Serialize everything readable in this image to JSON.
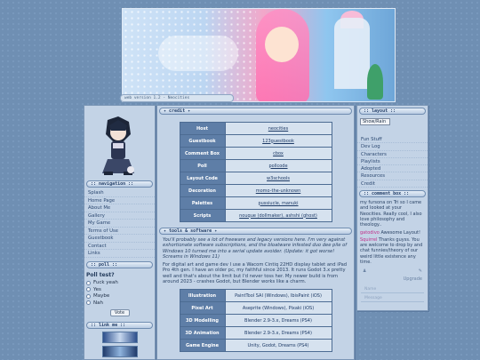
{
  "version_bar": "web version 1.2 - Neocities",
  "nav": {
    "title": ":: navigation ::",
    "items": [
      "Splash",
      "Home Page",
      "About Me",
      "Gallery",
      "My Game",
      "Terms of Use",
      "Guestbook",
      "Contact",
      "Links"
    ]
  },
  "poll": {
    "title": ":: poll ::",
    "question": "Poll test?",
    "options": [
      "Fuck yeah",
      "Yes",
      "Maybe",
      "Nah"
    ],
    "vote": "Vote"
  },
  "link_me": {
    "title": ":: link me ::"
  },
  "credit": {
    "title": "✦ credit ✦",
    "rows": [
      {
        "k": "Host",
        "v": "neocities"
      },
      {
        "k": "Guestbook",
        "v": "123guestbook"
      },
      {
        "k": "Comment Box",
        "v": "cbox"
      },
      {
        "k": "Poll",
        "v": "pollcode"
      },
      {
        "k": "Layout Code",
        "v": "w3schools"
      },
      {
        "k": "Decoration",
        "v": "momo-the-unknown"
      },
      {
        "k": "Palettes",
        "v": "pussiucle, manuki"
      },
      {
        "k": "Scripts",
        "v": "nouque (dollmaker), ashshi (ghost)"
      }
    ]
  },
  "tools": {
    "title": "✦ tools & software ✦",
    "p1": "You'll probably see a lot of freeware and legacy versions here. I'm very against exhortionate software subscriptions, and the bloatware infested duo dee pile of Windows 10 turned me into a serial update avoider. (Update: it got worse! Screams in Windows 11)",
    "p2": "For digital art and game dev I use a Wacom Cintiq 22HD display tablet and iPad Pro 4th gen. I have an older pc, my faithful since 2013. It runs Godot 3.x pretty well and that's about the limit but I'd never toss her. My newer build is from around 2023 - crashes Godot, but Blender works like a charm.",
    "rows": [
      {
        "k": "Illustration",
        "v": "PaintTool SAI (Windows), IbisPaint (iOS)"
      },
      {
        "k": "Pixel Art",
        "v": "Aseprite (Windows), Pixaki (iOS)"
      },
      {
        "k": "3D Modelling",
        "v": "Blender 2.9-3.x, Dreams (PS4)"
      },
      {
        "k": "3D Animation",
        "v": "Blender 2.9-3.x, Dreams (PS4)"
      },
      {
        "k": "Game Engine",
        "v": "Unity, Godot, Dreams (PS4)"
      }
    ]
  },
  "layout": {
    "title": ":: layout ::",
    "show_rain": "Show/Rain",
    "items": [
      "Fun Stuff",
      "Dev Log",
      "Characters",
      "Playlists",
      "Adopted",
      "Resources",
      "Credit"
    ]
  },
  "comment_box": {
    "title": ":: comment box ::",
    "c1": "my fursona on Tri so I came and looked at your Neocities. Really cool, I also love philosophy and theology..",
    "c2_name": "gatodivo",
    "c2_text": "Awesome Layout!",
    "c3_name": "Squirrel",
    "c3_text": "Thanks guyss. You are welcome to drop by and chat funnies/theory of our weird little existence any time.",
    "upgrade": "Upgrade",
    "name_ph": "Name",
    "msg_ph": "Message"
  }
}
